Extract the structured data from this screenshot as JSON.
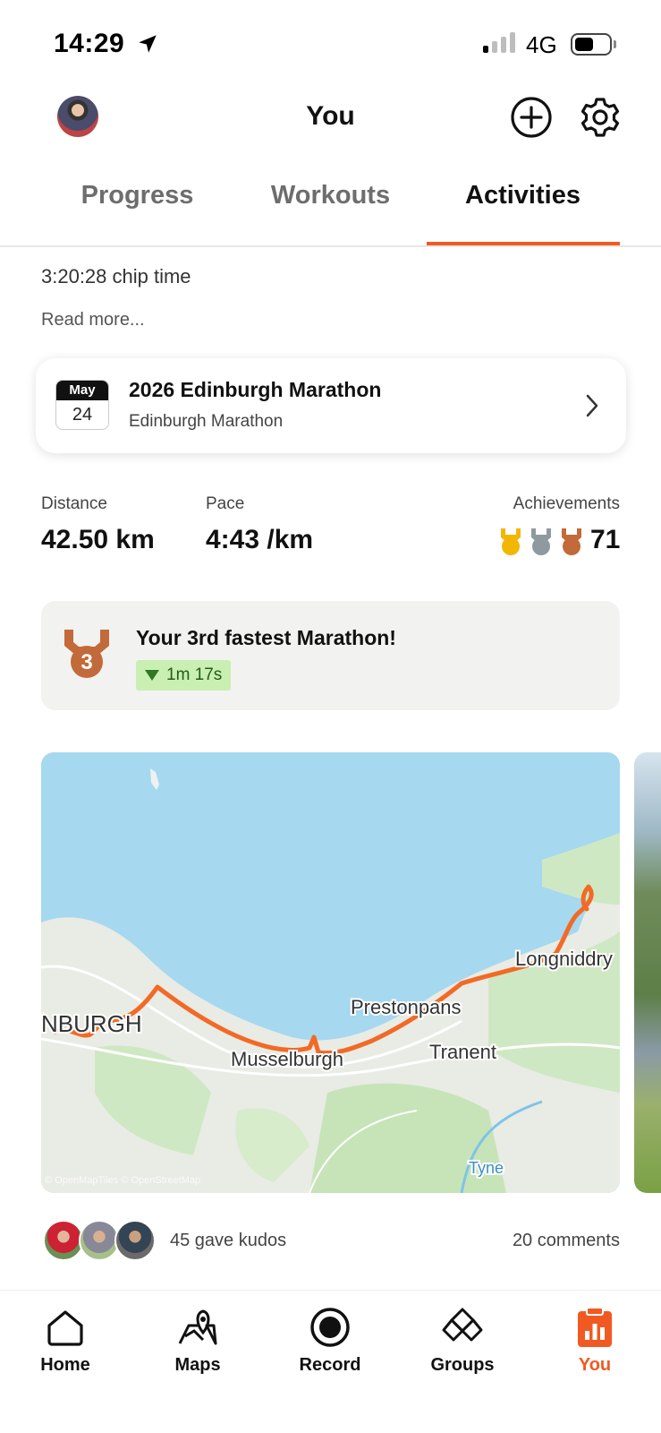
{
  "status_bar": {
    "time": "14:29",
    "network": "4G"
  },
  "header": {
    "title": "You"
  },
  "tabs": [
    {
      "label": "Progress"
    },
    {
      "label": "Workouts"
    },
    {
      "label": "Activities"
    }
  ],
  "activity": {
    "description_tail": "3:20:28 chip time",
    "read_more": "Read more...",
    "event": {
      "month": "May",
      "day": "24",
      "title": "2026 Edinburgh Marathon",
      "subtitle": "Edinburgh Marathon"
    },
    "stats": {
      "distance_label": "Distance",
      "distance_value": "42.50 km",
      "pace_label": "Pace",
      "pace_value": "4:43 /km",
      "achievements_label": "Achievements",
      "achievements_count": "71"
    },
    "best_effort": {
      "title": "Your 3rd fastest Marathon!",
      "medal_rank": "3",
      "delta": "1m 17s"
    },
    "map": {
      "labels": [
        "NBURGH",
        "Musselburgh",
        "Prestonpans",
        "Tranent",
        "Longniddry",
        "Tyne"
      ],
      "copyright": "© OpenMapTiles © OpenStreetMap"
    },
    "kudos_text": "45 gave kudos",
    "comments_text": "20 comments"
  },
  "bottom_nav": [
    {
      "label": "Home",
      "icon": "home-icon"
    },
    {
      "label": "Maps",
      "icon": "maps-icon"
    },
    {
      "label": "Record",
      "icon": "record-icon"
    },
    {
      "label": "Groups",
      "icon": "groups-icon"
    },
    {
      "label": "You",
      "icon": "you-icon"
    }
  ],
  "colors": {
    "accent": "#f05a22",
    "water": "#a6d8f0",
    "route": "#f26a25"
  }
}
